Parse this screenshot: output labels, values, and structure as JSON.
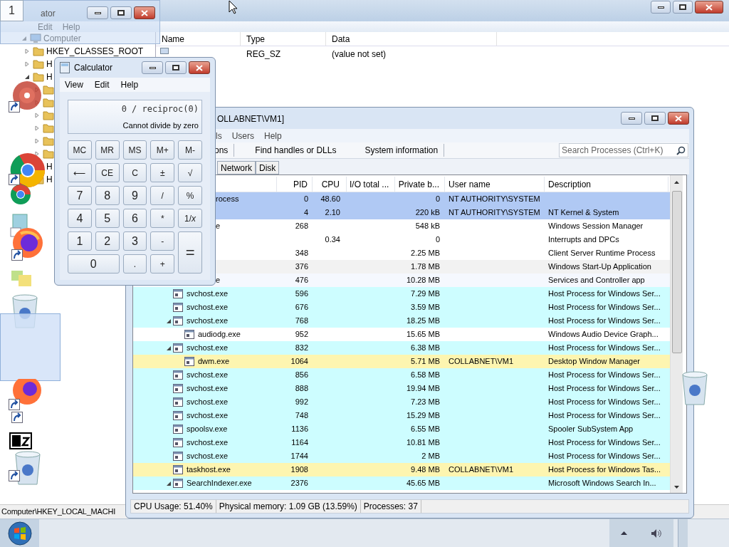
{
  "registry": {
    "badge": "1",
    "ghost_title": "ator",
    "menu": [
      "Edit",
      "Help"
    ],
    "tree": [
      {
        "label": "Computer",
        "expanded": true,
        "children": [
          {
            "label": "HKEY_CLASSES_ROOT",
            "expanded": false
          },
          {
            "label": "H",
            "expanded": false
          },
          {
            "label": "H",
            "expanded": true,
            "children": [
              {
                "expanded": false
              },
              {
                "expanded": false
              },
              {
                "expanded": false
              },
              {
                "expanded": false
              },
              {
                "expanded": false
              },
              {
                "expanded": false
              }
            ]
          },
          {
            "label": "H"
          },
          {
            "label": "H"
          }
        ]
      }
    ],
    "columns": [
      "Name",
      "Type",
      "Data"
    ],
    "rows": [
      {
        "type": "REG_SZ",
        "data": "(value not set)"
      }
    ],
    "status": "Computer\\HKEY_LOCAL_MACHI"
  },
  "calculator": {
    "title": "Calculator",
    "menu": [
      "View",
      "Edit",
      "Help"
    ],
    "expression": "0 / reciproc(0)",
    "result": "Cannot divide by zero",
    "buttons": [
      {
        "label": "MC",
        "kind": "memory"
      },
      {
        "label": "MR",
        "kind": "memory"
      },
      {
        "label": "MS",
        "kind": "memory"
      },
      {
        "label": "M+",
        "kind": "memory"
      },
      {
        "label": "M-",
        "kind": "memory"
      },
      {
        "label": "⟵",
        "kind": "op"
      },
      {
        "label": "CE",
        "kind": "memory"
      },
      {
        "label": "C",
        "kind": "memory"
      },
      {
        "label": "±",
        "kind": "op"
      },
      {
        "label": "√",
        "kind": "op"
      },
      {
        "label": "7",
        "kind": "digit"
      },
      {
        "label": "8",
        "kind": "digit"
      },
      {
        "label": "9",
        "kind": "digit"
      },
      {
        "label": "/",
        "kind": "op"
      },
      {
        "label": "%",
        "kind": "op"
      },
      {
        "label": "4",
        "kind": "digit"
      },
      {
        "label": "5",
        "kind": "digit"
      },
      {
        "label": "6",
        "kind": "digit"
      },
      {
        "label": "*",
        "kind": "op"
      },
      {
        "label": "1/*x*",
        "kind": "op"
      },
      {
        "label": "1",
        "kind": "digit"
      },
      {
        "label": "2",
        "kind": "digit"
      },
      {
        "label": "3",
        "kind": "digit"
      },
      {
        "label": "-",
        "kind": "op"
      },
      {
        "label": "=",
        "kind": "equals"
      },
      {
        "label": "0",
        "kind": "digit"
      },
      {
        "label": ".",
        "kind": "op"
      },
      {
        "label": "+",
        "kind": "op"
      }
    ]
  },
  "procexp": {
    "title": "OLLABNET\\VM1]",
    "menu": [
      "ls",
      "Users",
      "Help"
    ],
    "toolbar": [
      "ons",
      "Find handles or DLLs",
      "System information"
    ],
    "search": {
      "placeholder": "Search Processes (Ctrl+K)"
    },
    "tabs": [
      {
        "label": "Network",
        "selected": false
      },
      {
        "label": "Disk",
        "selected": false
      }
    ],
    "columns": [
      "PID",
      "CPU",
      "I/O total ...",
      "Private b...",
      "User name",
      "Description"
    ],
    "rows": [
      {
        "name": "rocess",
        "partial": true,
        "pid": "0",
        "cpu": "48.60",
        "private": "0",
        "user": "NT AUTHORITY\\SYSTEM",
        "color": "#b0c9f4"
      },
      {
        "pid": "4",
        "cpu": "2.10",
        "private": "220 kB",
        "user": "NT AUTHORITY\\SYSTEM",
        "description": "NT Kernel & System",
        "color": "#b0c9f4",
        "children": [
          {
            "name": "e",
            "partial": true,
            "pid": "268",
            "private": "548 kB",
            "description": "Windows Session Manager",
            "color": "#ffffff"
          }
        ]
      },
      {
        "cpu": "0.34",
        "private": "0",
        "description": "Interrupts and DPCs",
        "color": "#ffffff"
      },
      {
        "pid": "348",
        "private": "2.25 MB",
        "description": "Client Server Runtime Process",
        "color": "#ffffff"
      },
      {
        "pid": "376",
        "private": "1.78 MB",
        "description": "Windows Start-Up Application",
        "color": "#f2f2f2",
        "children": [
          {
            "name": "e",
            "partial": true,
            "pid": "476",
            "private": "10.28 MB",
            "description": "Services and Controller app",
            "color": "#f5f8fe",
            "children": [
              {
                "name": "svchost.exe",
                "pid": "596",
                "private": "7.29 MB",
                "description": "Host Process for Windows Ser...",
                "color": "#cdfdff"
              },
              {
                "name": "svchost.exe",
                "pid": "676",
                "private": "3.59 MB",
                "description": "Host Process for Windows Ser...",
                "color": "#cdfdff"
              },
              {
                "name": "svchost.exe",
                "pid": "768",
                "private": "18.25 MB",
                "description": "Host Process for Windows Ser...",
                "color": "#cdfdff",
                "expanded": true,
                "children": [
                  {
                    "name": "audiodg.exe",
                    "pid": "952",
                    "private": "15.65 MB",
                    "description": "Windows Audio Device Graph...",
                    "color": "#ffffff"
                  }
                ]
              },
              {
                "name": "svchost.exe",
                "pid": "832",
                "private": "6.38 MB",
                "description": "Host Process for Windows Ser...",
                "color": "#cdfdff",
                "expanded": true,
                "children": [
                  {
                    "name": "dwm.exe",
                    "pid": "1064",
                    "private": "5.71 MB",
                    "user": "COLLABNET\\VM1",
                    "description": "Desktop Window Manager",
                    "color": "#fdf5b0"
                  }
                ]
              },
              {
                "name": "svchost.exe",
                "pid": "856",
                "private": "6.58 MB",
                "description": "Host Process for Windows Ser...",
                "color": "#cdfdff"
              },
              {
                "name": "svchost.exe",
                "pid": "888",
                "private": "19.94 MB",
                "description": "Host Process for Windows Ser...",
                "color": "#cdfdff"
              },
              {
                "name": "svchost.exe",
                "pid": "992",
                "private": "7.23 MB",
                "description": "Host Process for Windows Ser...",
                "color": "#cdfdff"
              },
              {
                "name": "svchost.exe",
                "pid": "748",
                "private": "15.29 MB",
                "description": "Host Process for Windows Ser...",
                "color": "#cdfdff"
              },
              {
                "name": "spoolsv.exe",
                "pid": "1136",
                "private": "6.55 MB",
                "description": "Spooler SubSystem App",
                "color": "#cdfdff"
              },
              {
                "name": "svchost.exe",
                "pid": "1164",
                "private": "10.81 MB",
                "description": "Host Process for Windows Ser...",
                "color": "#cdfdff"
              },
              {
                "name": "svchost.exe",
                "pid": "1744",
                "private": "2 MB",
                "description": "Host Process for Windows Ser...",
                "color": "#cdfdff"
              },
              {
                "name": "taskhost.exe",
                "pid": "1908",
                "private": "9.48 MB",
                "user": "COLLABNET\\VM1",
                "description": "Host Process for Windows Tas...",
                "color": "#fdf5b0"
              },
              {
                "name": "SearchIndexer.exe",
                "pid": "2376",
                "private": "45.65 MB",
                "description": "Microsoft Windows Search In...",
                "color": "#cdfdff",
                "expanded": true
              }
            ]
          }
        ]
      }
    ],
    "status": [
      "CPU Usage: 51.40%",
      "Physical memory: 1.09 GB (13.59%)",
      "Processes: 37"
    ]
  }
}
